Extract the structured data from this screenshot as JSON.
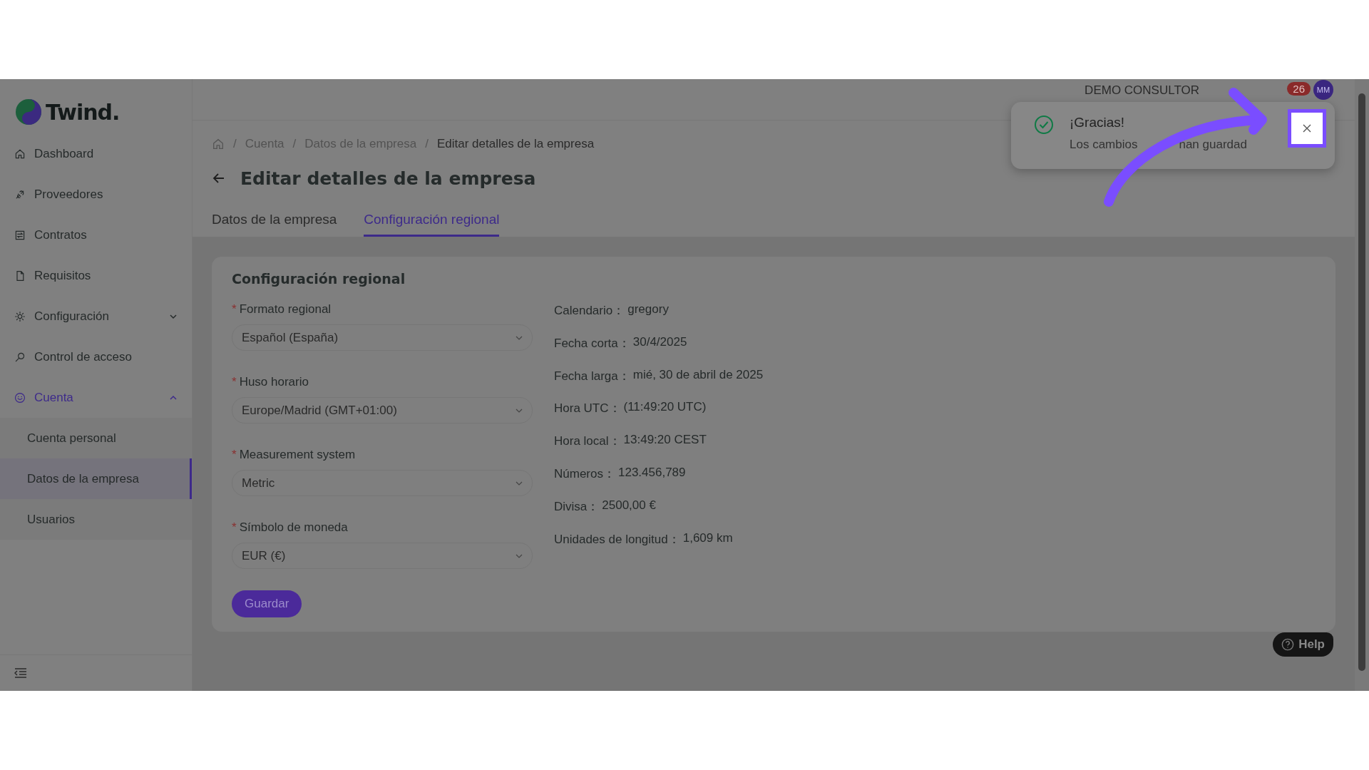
{
  "logo": {
    "text": "Twind."
  },
  "sidebar": {
    "items": [
      {
        "label": "Dashboard",
        "selected": false
      },
      {
        "label": "Proveedores",
        "selected": false
      },
      {
        "label": "Contratos",
        "selected": false
      },
      {
        "label": "Requisitos",
        "selected": false
      },
      {
        "label": "Configuración",
        "selected": false,
        "expanded": false
      },
      {
        "label": "Control de acceso",
        "selected": false
      },
      {
        "label": "Cuenta",
        "selected": true,
        "expanded": true,
        "children": [
          {
            "label": "Cuenta personal",
            "selected": false
          },
          {
            "label": "Datos de la empresa",
            "selected": true
          },
          {
            "label": "Usuarios",
            "selected": false
          }
        ]
      }
    ]
  },
  "header": {
    "account": "DEMO CONSULTOR",
    "notifications": "26",
    "avatar": "MM"
  },
  "toast": {
    "title": "¡Gracias!",
    "message_parts": [
      "Los cambios",
      "han guardad"
    ]
  },
  "breadcrumb_separator": "/",
  "breadcrumbs": [
    "Cuenta",
    "Datos de la empresa",
    "Editar detalles de la empresa"
  ],
  "title": "Editar detalles de la empresa",
  "tabs": [
    {
      "label": "Datos de la empresa",
      "selected": false
    },
    {
      "label": "Configuración regional",
      "selected": true
    }
  ],
  "card": {
    "title": "Configuración regional",
    "required_mark": "*",
    "fields": [
      {
        "label": "Formato regional",
        "value": "Español (España)",
        "required": true
      },
      {
        "label": "Huso horario",
        "value": "Europe/Madrid (GMT+01:00)",
        "required": true
      },
      {
        "label": "Measurement system",
        "value": "Metric",
        "required": true
      },
      {
        "label": "Símbolo de moneda",
        "value": "EUR (€)",
        "required": true
      }
    ],
    "info": [
      {
        "label": "Calendario：",
        "value": "gregory"
      },
      {
        "label": "Fecha corta：",
        "value": "30/4/2025"
      },
      {
        "label": "Fecha larga：",
        "value": "mié, 30 de abril de 2025"
      },
      {
        "label": "Hora UTC：",
        "value": "(11:49:20 UTC)"
      },
      {
        "label": "Hora local：",
        "value": "13:49:20 CEST"
      },
      {
        "label": "Números：",
        "value": "123.456,789"
      },
      {
        "label": "Divisa：",
        "value": "2500,00 €"
      },
      {
        "label": "Unidades de longitud：",
        "value": "1,609 km"
      }
    ],
    "save": "Guardar"
  },
  "help": "Help"
}
